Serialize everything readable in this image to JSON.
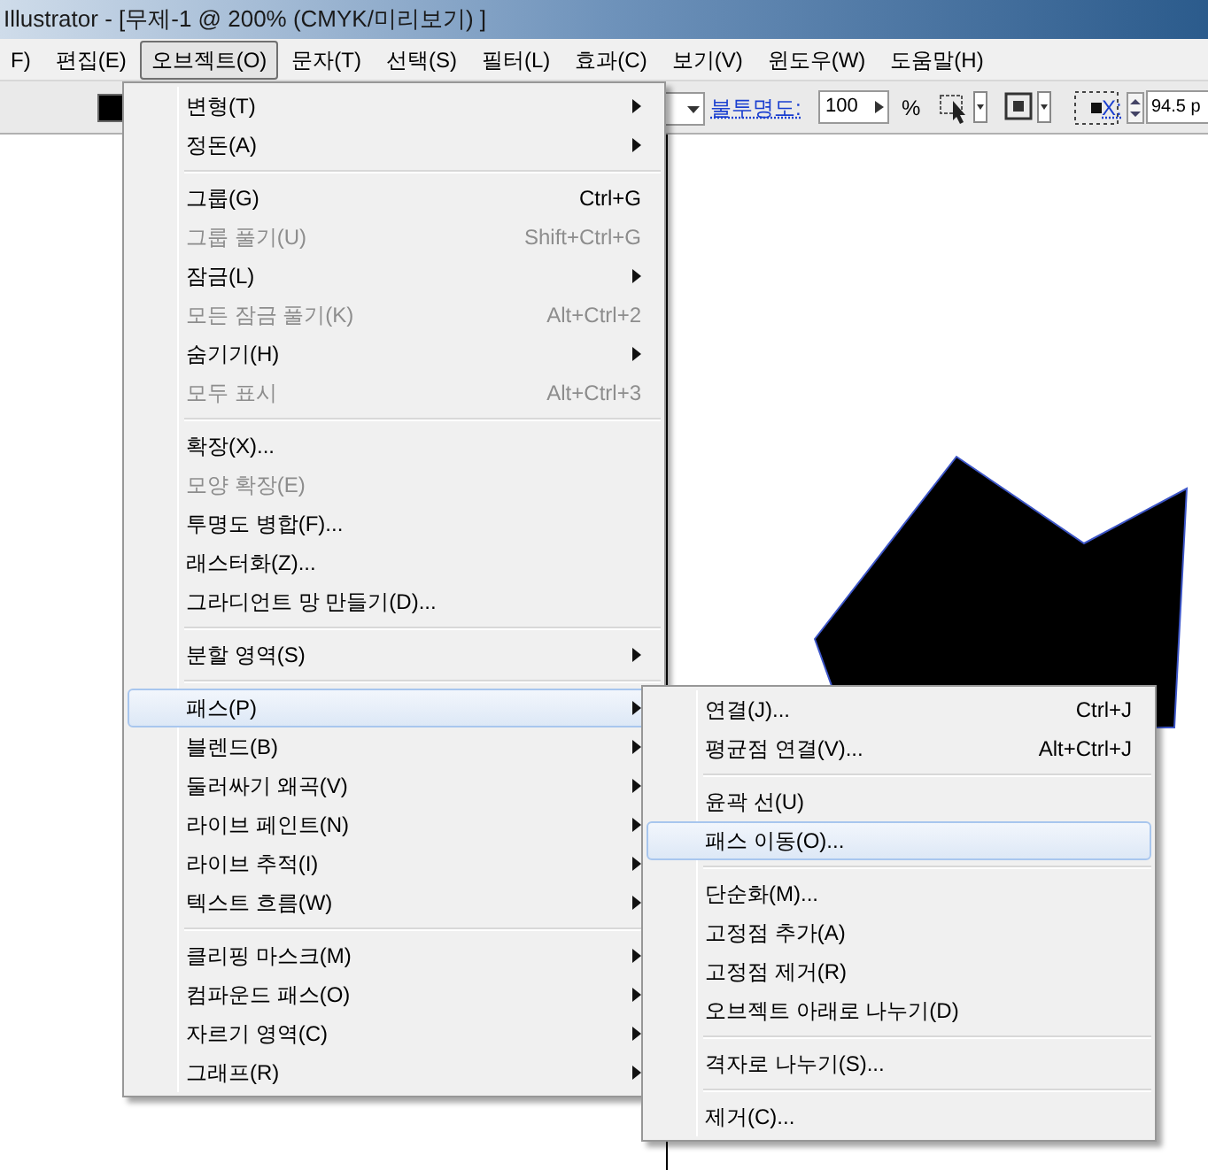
{
  "window": {
    "title": "Illustrator - [무제-1 @ 200% (CMYK/미리보기) ]"
  },
  "menu_bar": [
    {
      "label": "F)",
      "selected": false
    },
    {
      "label": "편집(E)",
      "selected": false
    },
    {
      "label": "오브젝트(O)",
      "selected": true
    },
    {
      "label": "문자(T)",
      "selected": false
    },
    {
      "label": "선택(S)",
      "selected": false
    },
    {
      "label": "필터(L)",
      "selected": false
    },
    {
      "label": "효과(C)",
      "selected": false
    },
    {
      "label": "보기(V)",
      "selected": false
    },
    {
      "label": "윈도우(W)",
      "selected": false
    },
    {
      "label": "도움말(H)",
      "selected": false
    }
  ],
  "control_bar": {
    "opacity_label": "불투명도:",
    "opacity_value": "100",
    "opacity_unit": "%",
    "x_label": "X:",
    "x_value": "94.5 p"
  },
  "object_menu": [
    [
      {
        "label": "변형(T)",
        "submenu": true,
        "disabled": false,
        "selected": false
      },
      {
        "label": "정돈(A)",
        "submenu": true,
        "disabled": false,
        "selected": false
      }
    ],
    [
      {
        "label": "그룹(G)",
        "shortcut": "Ctrl+G",
        "submenu": false,
        "disabled": false,
        "selected": false
      },
      {
        "label": "그룹 풀기(U)",
        "shortcut": "Shift+Ctrl+G",
        "submenu": false,
        "disabled": true,
        "selected": false
      },
      {
        "label": "잠금(L)",
        "submenu": true,
        "disabled": false,
        "selected": false
      },
      {
        "label": "모든 잠금 풀기(K)",
        "shortcut": "Alt+Ctrl+2",
        "submenu": false,
        "disabled": true,
        "selected": false
      },
      {
        "label": "숨기기(H)",
        "submenu": true,
        "disabled": false,
        "selected": false
      },
      {
        "label": "모두 표시",
        "shortcut": "Alt+Ctrl+3",
        "submenu": false,
        "disabled": true,
        "selected": false
      }
    ],
    [
      {
        "label": "확장(X)...",
        "submenu": false,
        "disabled": false,
        "selected": false
      },
      {
        "label": "모양 확장(E)",
        "submenu": false,
        "disabled": true,
        "selected": false
      },
      {
        "label": "투명도 병합(F)...",
        "submenu": false,
        "disabled": false,
        "selected": false
      },
      {
        "label": "래스터화(Z)...",
        "submenu": false,
        "disabled": false,
        "selected": false
      },
      {
        "label": "그라디언트 망 만들기(D)...",
        "submenu": false,
        "disabled": false,
        "selected": false
      }
    ],
    [
      {
        "label": "분할 영역(S)",
        "submenu": true,
        "disabled": false,
        "selected": false
      }
    ],
    [
      {
        "label": "패스(P)",
        "submenu": true,
        "disabled": false,
        "selected": true
      },
      {
        "label": "블렌드(B)",
        "submenu": true,
        "disabled": false,
        "selected": false
      },
      {
        "label": "둘러싸기 왜곡(V)",
        "submenu": true,
        "disabled": false,
        "selected": false
      },
      {
        "label": "라이브 페인트(N)",
        "submenu": true,
        "disabled": false,
        "selected": false
      },
      {
        "label": "라이브 추적(I)",
        "submenu": true,
        "disabled": false,
        "selected": false
      },
      {
        "label": "텍스트 흐름(W)",
        "submenu": true,
        "disabled": false,
        "selected": false
      }
    ],
    [
      {
        "label": "클리핑 마스크(M)",
        "submenu": true,
        "disabled": false,
        "selected": false
      },
      {
        "label": "컴파운드 패스(O)",
        "submenu": true,
        "disabled": false,
        "selected": false
      },
      {
        "label": "자르기 영역(C)",
        "submenu": true,
        "disabled": false,
        "selected": false
      },
      {
        "label": "그래프(R)",
        "submenu": true,
        "disabled": false,
        "selected": false
      }
    ]
  ],
  "path_submenu": [
    [
      {
        "label": "연결(J)...",
        "shortcut": "Ctrl+J",
        "submenu": false,
        "disabled": false,
        "selected": false
      },
      {
        "label": "평균점 연결(V)...",
        "shortcut": "Alt+Ctrl+J",
        "submenu": false,
        "disabled": false,
        "selected": false
      }
    ],
    [
      {
        "label": "윤곽 선(U)",
        "submenu": false,
        "disabled": false,
        "selected": false
      },
      {
        "label": "패스 이동(O)...",
        "submenu": false,
        "disabled": false,
        "selected": true
      }
    ],
    [
      {
        "label": "단순화(M)...",
        "submenu": false,
        "disabled": false,
        "selected": false
      },
      {
        "label": "고정점 추가(A)",
        "submenu": false,
        "disabled": false,
        "selected": false
      },
      {
        "label": "고정점 제거(R)",
        "submenu": false,
        "disabled": false,
        "selected": false
      },
      {
        "label": "오브젝트 아래로 나누기(D)",
        "submenu": false,
        "disabled": false,
        "selected": false
      }
    ],
    [
      {
        "label": "격자로 나누기(S)...",
        "submenu": false,
        "disabled": false,
        "selected": false
      }
    ],
    [
      {
        "label": "제거(C)...",
        "submenu": false,
        "disabled": false,
        "selected": false
      }
    ]
  ]
}
